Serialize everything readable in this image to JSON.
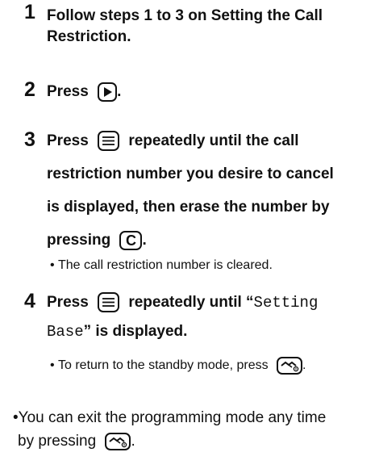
{
  "steps": [
    {
      "number": "1",
      "lines": [
        "Follow steps 1 to 3 on Setting the Call",
        "Restriction."
      ]
    },
    {
      "number": "2",
      "text": "Press",
      "after": "."
    },
    {
      "number": "3",
      "lines": [
        "Press",
        "repeatedly until the call",
        "restriction number you desire to cancel",
        "is displayed, then erase the number by",
        "pressing",
        "."
      ],
      "bullet": "The call restriction number is cleared."
    },
    {
      "number": "4",
      "line1_pre": "Press",
      "line1_mid": "repeatedly until “",
      "display_text_1": "Setting",
      "display_text_2": "Base",
      "line2_post": "” is displayed.",
      "bullet": "To return to the standby mode, press",
      "bullet_after": "."
    }
  ],
  "note": {
    "line1": "You can exit the programming mode any time",
    "line2": "by pressing",
    "after": "."
  },
  "keys": {
    "c_label": "C"
  },
  "icons": {
    "right": "right-arrow-key-icon",
    "menu": "menu-key-icon",
    "off": "off-key-icon"
  }
}
